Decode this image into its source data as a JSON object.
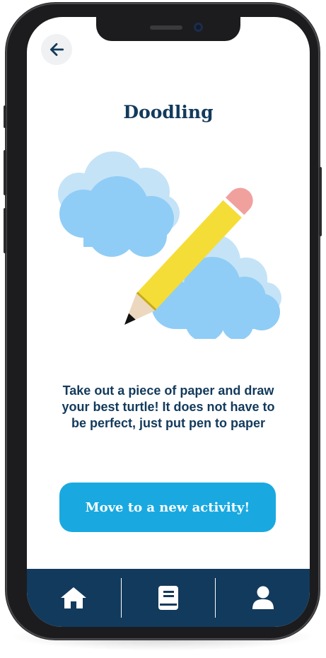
{
  "screen": {
    "title": "Doodling",
    "description": "Take out a piece of paper and draw your best turtle! It does not have to be perfect, just put pen to paper",
    "illustration": "pencil-with-clouds"
  },
  "actions": {
    "back_icon": "arrow-left-icon",
    "next_activity_label": "Move to a new activity!"
  },
  "tabbar": {
    "items": [
      {
        "name": "home",
        "icon": "home-icon"
      },
      {
        "name": "journal",
        "icon": "book-icon"
      },
      {
        "name": "profile",
        "icon": "user-icon"
      }
    ]
  },
  "colors": {
    "navy": "#123a5c",
    "accent": "#19a9e0",
    "cloud": "#8fcdf6",
    "cloud_shadow": "#c5e3f7",
    "pencil_body": "#f5dd37",
    "pencil_eraser": "#f0a19e"
  }
}
